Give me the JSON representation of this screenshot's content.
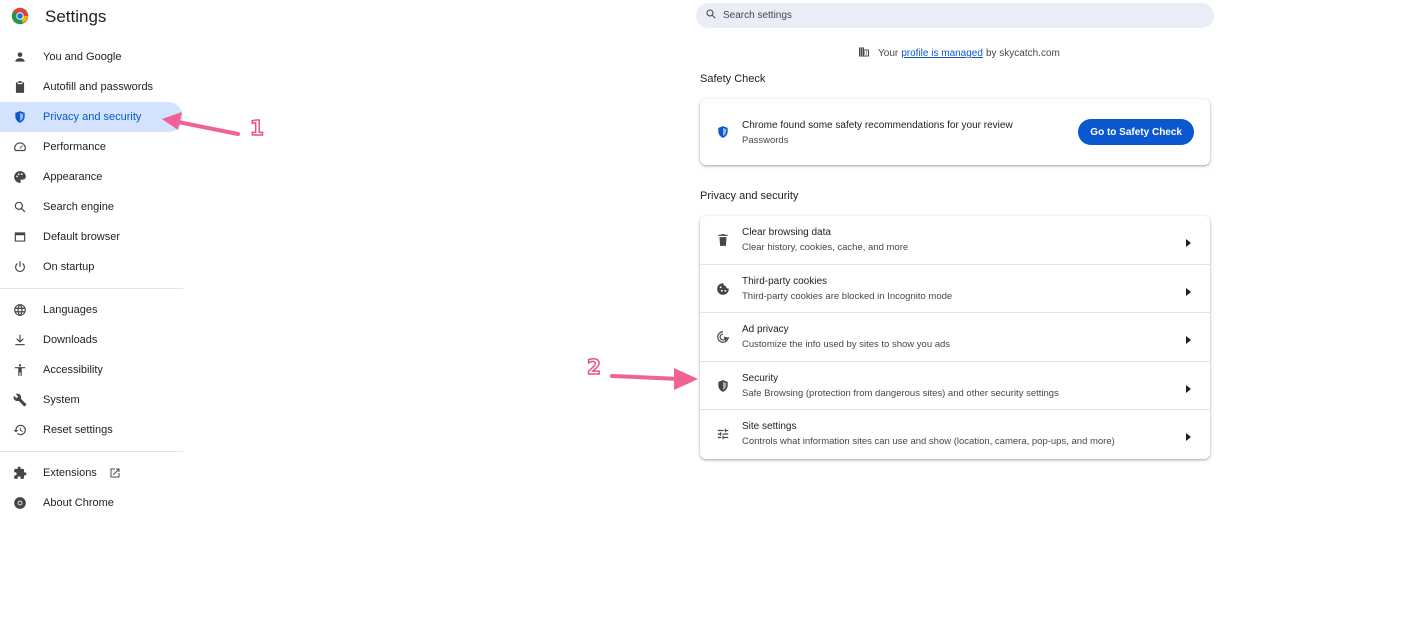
{
  "app": {
    "title": "Settings"
  },
  "search": {
    "placeholder": "Search settings"
  },
  "managed": {
    "prefix": "Your",
    "link": "profile is managed",
    "suffix": "by skycatch.com"
  },
  "sidebar": {
    "items": [
      {
        "label": "You and Google",
        "icon": "person-icon"
      },
      {
        "label": "Autofill and passwords",
        "icon": "clipboard-icon"
      },
      {
        "label": "Privacy and security",
        "icon": "shield-icon",
        "active": true
      },
      {
        "label": "Performance",
        "icon": "speedometer-icon"
      },
      {
        "label": "Appearance",
        "icon": "palette-icon"
      },
      {
        "label": "Search engine",
        "icon": "search-icon"
      },
      {
        "label": "Default browser",
        "icon": "browser-icon"
      },
      {
        "label": "On startup",
        "icon": "power-icon"
      },
      {
        "label": "Languages",
        "icon": "globe-icon"
      },
      {
        "label": "Downloads",
        "icon": "download-icon"
      },
      {
        "label": "Accessibility",
        "icon": "accessibility-icon"
      },
      {
        "label": "System",
        "icon": "wrench-icon"
      },
      {
        "label": "Reset settings",
        "icon": "reset-icon"
      },
      {
        "label": "Extensions",
        "icon": "puzzle-icon"
      },
      {
        "label": "About Chrome",
        "icon": "chrome-icon"
      }
    ]
  },
  "safety_check": {
    "heading": "Safety Check",
    "title": "Chrome found some safety recommendations for your review",
    "subtitle": "Passwords",
    "button": "Go to Safety Check"
  },
  "privacy": {
    "heading": "Privacy and security",
    "rows": [
      {
        "title": "Clear browsing data",
        "subtitle": "Clear history, cookies, cache, and more",
        "icon": "trash-icon"
      },
      {
        "title": "Third-party cookies",
        "subtitle": "Third-party cookies are blocked in Incognito mode",
        "icon": "cookie-icon"
      },
      {
        "title": "Ad privacy",
        "subtitle": "Customize the info used by sites to show you ads",
        "icon": "ad-privacy-icon"
      },
      {
        "title": "Security",
        "subtitle": "Safe Browsing (protection from dangerous sites) and other security settings",
        "icon": "security-shield-icon"
      },
      {
        "title": "Site settings",
        "subtitle": "Controls what information sites can use and show (location, camera, pop-ups, and more)",
        "icon": "sliders-icon"
      }
    ]
  },
  "annotations": {
    "one": "1",
    "two": "2",
    "color": "#f06292"
  }
}
